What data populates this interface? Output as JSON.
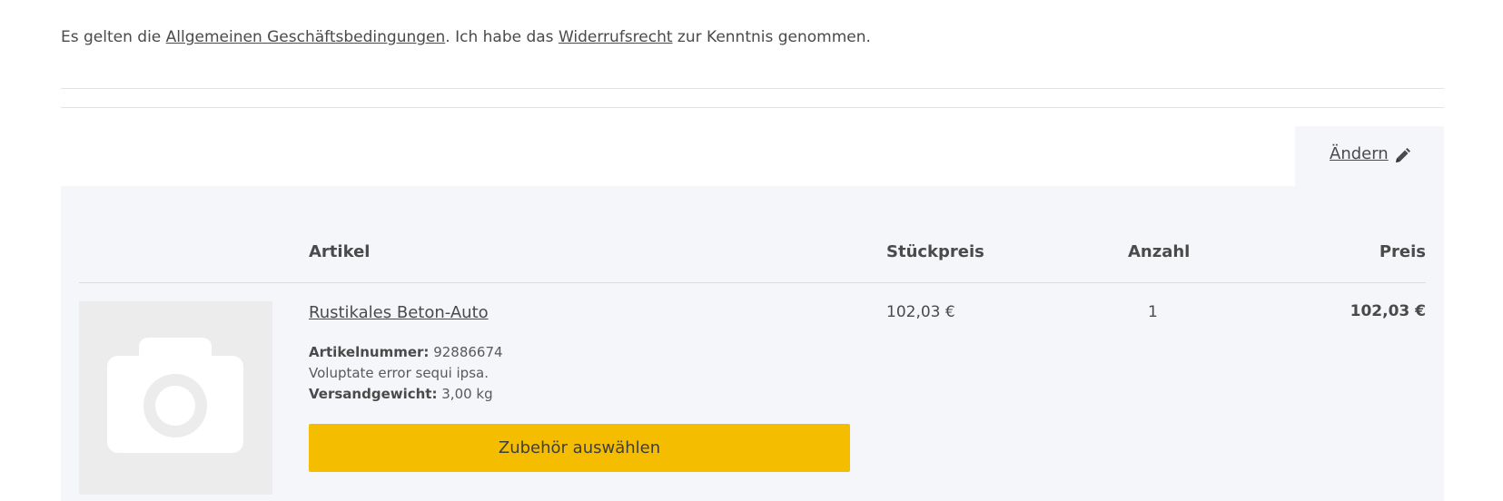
{
  "terms": {
    "prefix": "Es gelten die ",
    "agb_link": "Allgemeinen Geschäftsbedingungen",
    "middle": ". Ich habe das ",
    "withdrawal_link": "Widerrufsrecht",
    "suffix": " zur Kenntnis genommen."
  },
  "cart_section": {
    "edit_label": "Ändern",
    "edit_icon": "pencil-icon"
  },
  "table": {
    "headers": {
      "article": "Artikel",
      "unit_price": "Stückpreis",
      "quantity": "Anzahl",
      "price": "Preis"
    },
    "items": [
      {
        "image_icon": "camera-icon",
        "name": "Rustikales Beton-Auto",
        "article_number_label": "Artikelnummer:",
        "article_number": "92886674",
        "description": "Voluptate error sequi ipsa.",
        "weight_label": "Versandgewicht:",
        "weight": "3,00 kg",
        "accessory_button": "Zubehör auswählen",
        "unit_price": "102,03 €",
        "quantity": "1",
        "total": "102,03 €"
      }
    ]
  },
  "colors": {
    "accent": "#f5bd00",
    "panel_bg": "#f4f6f9",
    "text": "#4a4a4a"
  }
}
